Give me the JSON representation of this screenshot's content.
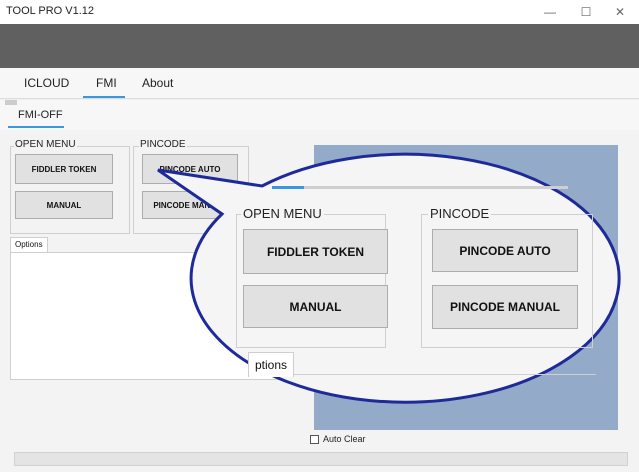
{
  "window": {
    "title": "TOOL PRO V1.12",
    "minimize_glyph": "—",
    "maximize_glyph": "☐",
    "close_glyph": "✕"
  },
  "tabs": [
    "ICLOUD",
    "FMI",
    "About"
  ],
  "active_tab": "FMI",
  "subtab": "FMI-OFF",
  "open_menu": {
    "label": "OPEN MENU",
    "fiddler_token": "FIDDLER TOKEN",
    "manual": "MANUAL"
  },
  "pincode": {
    "label": "PINCODE",
    "auto": "PINCODE AUTO",
    "manual": "PINCODE MANUAL"
  },
  "options_tab": "Options",
  "auto_clear_label": "Auto Clear",
  "zoom_callout": {
    "open_menu_label": "OPEN MENU",
    "fiddler_token": "FIDDLER TOKEN",
    "manual": "MANUAL",
    "pincode_label": "PINCODE",
    "pincode_auto": "PINCODE AUTO",
    "pincode_manual": "PINCODE MANUAL",
    "options_partial": "ptions"
  },
  "colors": {
    "accent": "#3a96dd",
    "log_panel": "#93aac9",
    "callout_border": "#1f2a9a",
    "header_band": "#606060"
  }
}
